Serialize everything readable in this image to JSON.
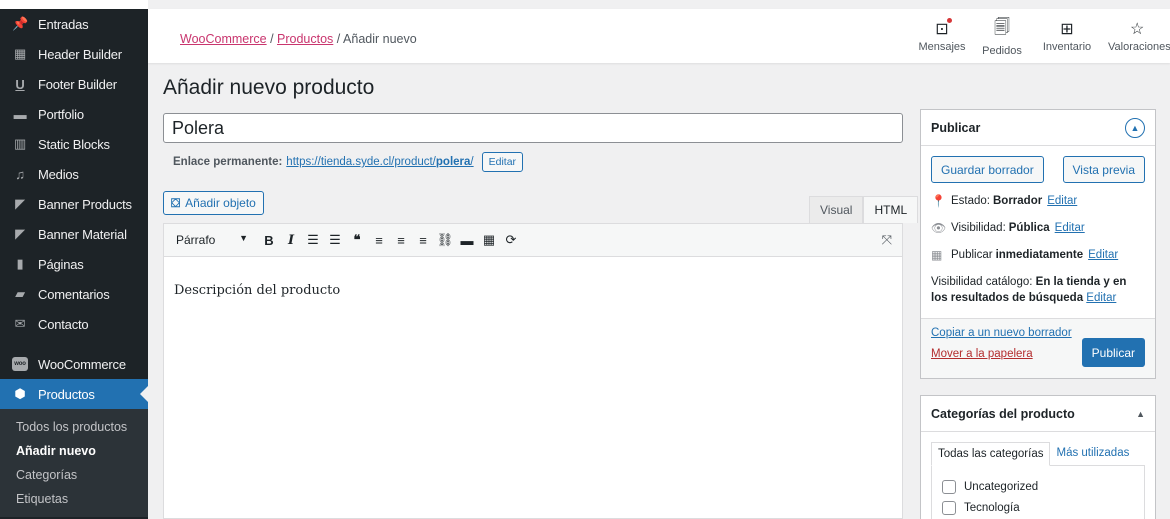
{
  "sidebar": {
    "items": [
      {
        "label": "Entradas",
        "icon": "pin-icon"
      },
      {
        "label": "Header Builder",
        "icon": "table-icon"
      },
      {
        "label": "Footer Builder",
        "icon": "underline-icon"
      },
      {
        "label": "Portfolio",
        "icon": "folder-icon"
      },
      {
        "label": "Static Blocks",
        "icon": "blocks-icon"
      },
      {
        "label": "Medios",
        "icon": "media-icon"
      },
      {
        "label": "Banner Products",
        "icon": "megaphone-icon"
      },
      {
        "label": "Banner Material",
        "icon": "megaphone-icon"
      },
      {
        "label": "Páginas",
        "icon": "page-icon"
      },
      {
        "label": "Comentarios",
        "icon": "comment-icon"
      },
      {
        "label": "Contacto",
        "icon": "mail-icon"
      }
    ],
    "woocommerce": {
      "label": "WooCommerce",
      "logo_text": "woo"
    },
    "productos": {
      "label": "Productos"
    },
    "submenu": [
      "Todos los productos",
      "Añadir nuevo",
      "Categorías",
      "Etiquetas"
    ]
  },
  "topbar": {
    "breadcrumb": {
      "link1": "WooCommerce",
      "sep1": " / ",
      "link2": "Productos",
      "sep2": " / ",
      "current": "Añadir nuevo"
    },
    "icons": [
      {
        "label": "Mensajes",
        "icon": "inbox-icon"
      },
      {
        "label": "Pedidos",
        "icon": "orders-icon"
      },
      {
        "label": "Inventario",
        "icon": "inventory-icon"
      },
      {
        "label": "Valoraciones",
        "icon": "star-icon"
      }
    ]
  },
  "main": {
    "page_title": "Añadir nuevo producto",
    "title_value": "Polera",
    "permalink_label": "Enlace permanente:",
    "permalink_base": "https://tienda.syde.cl/product/",
    "permalink_slug": "polera",
    "permalink_tail": "/",
    "permalink_edit": "Editar",
    "add_media": "Añadir objeto",
    "tab_visual": "Visual",
    "tab_html": "HTML",
    "format_select": "Párrafo",
    "editor_text": "Descripción del producto"
  },
  "publish": {
    "title": "Publicar",
    "save_draft": "Guardar borrador",
    "preview": "Vista previa",
    "status_label": "Estado:",
    "status_value": "Borrador",
    "visibility_label": "Visibilidad:",
    "visibility_value": "Pública",
    "publish_label": "Publicar",
    "publish_value": "inmediatamente",
    "edit": "Editar",
    "catalog_label": "Visibilidad catálogo:",
    "catalog_value": "En la tienda y en los resultados de búsqueda",
    "copy_draft": "Copiar a un nuevo borrador",
    "trash": "Mover a la papelera",
    "publish_button": "Publicar"
  },
  "categories": {
    "title": "Categorías del producto",
    "tab_all": "Todas las categorías",
    "tab_used": "Más utilizadas",
    "items": [
      "Uncategorized",
      "Tecnología"
    ]
  },
  "colors": {
    "accent": "#2271b1",
    "sidebar": "#1d2327",
    "woo_link": "#c9356e",
    "trash": "#b32d2e"
  }
}
